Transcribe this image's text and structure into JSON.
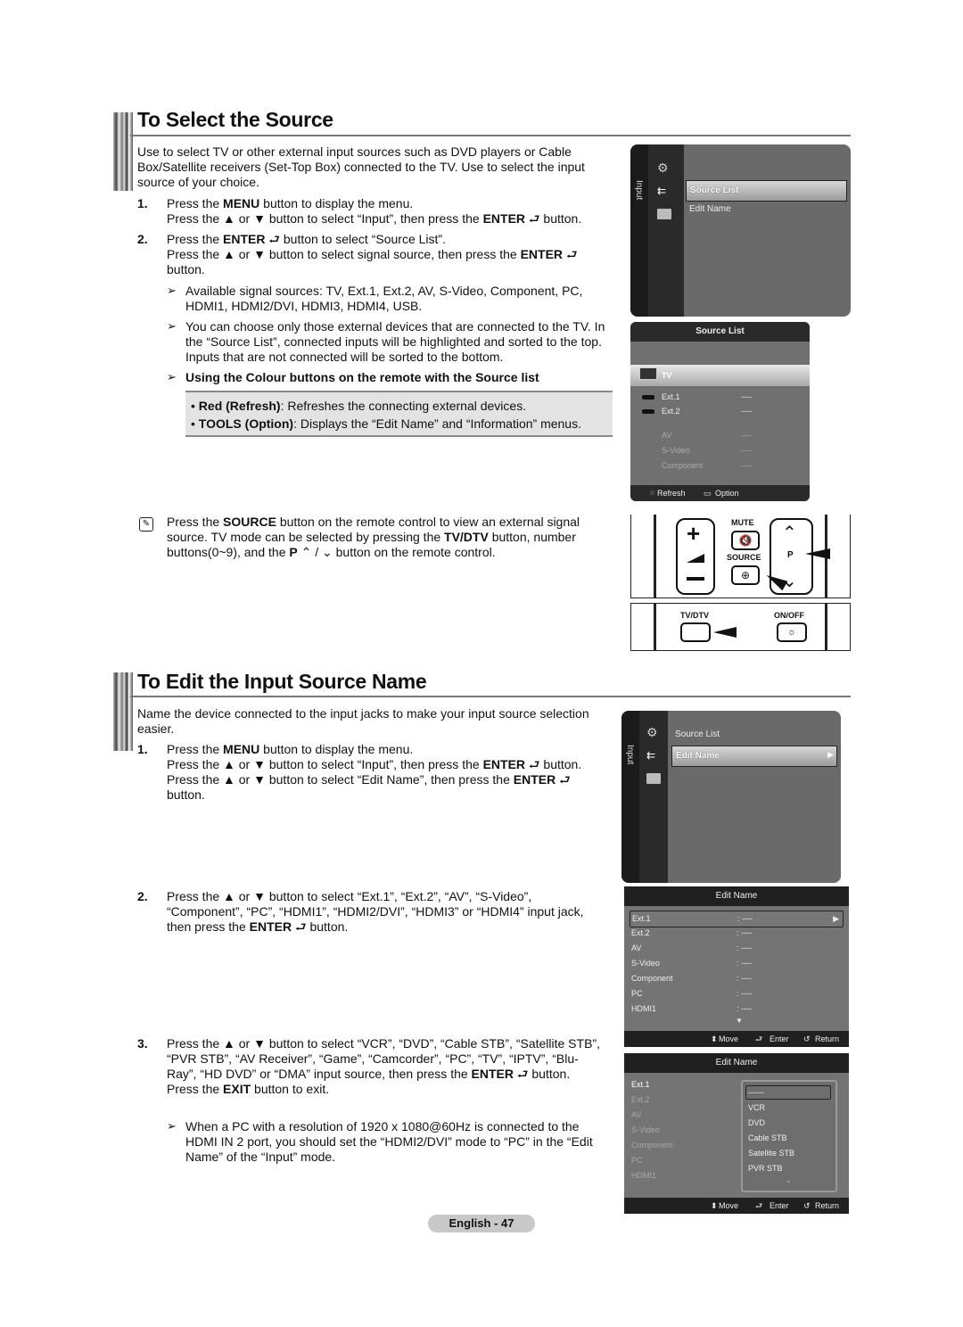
{
  "section1": {
    "title": "To Select the Source",
    "intro": "Use to select TV or other external input sources such as DVD players or Cable Box/Satellite receivers (Set-Top Box) connected to the TV. Use to select the input source of your choice.",
    "step1_num": "1.",
    "step1_line1_pre": "Press the ",
    "step1_line1_bold": "MENU",
    "step1_line1_post": " button to display the menu.",
    "step1_line2_pre": "Press the ▲ or ▼ button to select “Input”, then press the ",
    "step1_line2_bold": "ENTER",
    "step1_line2_post": " button.",
    "step2_num": "2.",
    "step2_line1_pre": "Press the ",
    "step2_line1_bold": "ENTER",
    "step2_line1_post": " button to select “Source List”.",
    "step2_line2_pre": "Press the ▲ or ▼ button to select signal source, then press the ",
    "step2_line2_bold": "ENTER",
    "step2_line2_post": "button.",
    "note1": "Available signal sources: TV, Ext.1, Ext.2, AV, S-Video, Component, PC, HDMI1, HDMI2/DVI, HDMI3, HDMI4, USB.",
    "note2": "You can choose only those external devices that are connected to the TV. In the “Source List”, connected inputs will be highlighted and sorted to the top. Inputs that are not connected will be sorted to the bottom.",
    "note3": "Using the Colour buttons on the remote with the Source list",
    "box_item1_bold": "Red (Refresh)",
    "box_item1_text": ": Refreshes the connecting external devices.",
    "box_item2_bold": "TOOLS (Option)",
    "box_item2_text": ": Displays the “Edit Name” and “Information” menus.",
    "memo_pre": "Press the ",
    "memo_b1": "SOURCE",
    "memo_mid1": " button on the remote control to view an external signal source. TV mode can be selected by pressing the ",
    "memo_b2": "TV/DTV",
    "memo_mid2": " button, number buttons(0~9), and the ",
    "memo_b3": "P",
    "memo_post": " ⌃ / ⌄ button on the remote control."
  },
  "menu1": {
    "category": "Input",
    "items": [
      "Source List",
      "Edit Name"
    ],
    "selected": 0
  },
  "source_list": {
    "title": "Source List",
    "rows": [
      {
        "label": "TV",
        "value": "",
        "state": "selected"
      },
      {
        "label": "Ext.1",
        "value": "----",
        "state": "connected"
      },
      {
        "label": "Ext.2",
        "value": "----",
        "state": "connected"
      },
      {
        "label": "AV",
        "value": "----",
        "state": "dim"
      },
      {
        "label": "S-Video",
        "value": "----",
        "state": "dim"
      },
      {
        "label": "Component",
        "value": "----",
        "state": "dim"
      }
    ],
    "footer_refresh": "Refresh",
    "footer_option": "Option"
  },
  "remote": {
    "mute": "MUTE",
    "source": "SOURCE",
    "p": "P",
    "tvdtv": "TV/DTV",
    "onoff": "ON/OFF"
  },
  "section2": {
    "title": "To Edit the Input Source Name",
    "intro": "Name the device connected to the input jacks to make your input source selection easier.",
    "step1_num": "1.",
    "step1_line1_pre": "Press the ",
    "step1_line1_bold": "MENU",
    "step1_line1_post": " button to display the menu.",
    "step1_line2_pre": "Press the ▲ or ▼ button to select “Input”, then press the ",
    "step1_line2_bold": "ENTER",
    "step1_line2_post": " button.",
    "step1_line3_pre": "Press the ▲ or ▼ button to select “Edit Name”, then press the ",
    "step1_line3_bold": "ENTER",
    "step1_line3_post": "button.",
    "step2_num": "2.",
    "step2_text": "Press the ▲ or ▼ button to select “Ext.1”, “Ext.2”, “AV”, “S-Video”, “Component”, “PC”, “HDMI1”, “HDMI2/DVI”, “HDMI3” or “HDMI4” input jack, then press the ",
    "step2_bold": "ENTER",
    "step2_post": " button.",
    "step3_num": "3.",
    "step3_text": "Press the ▲ or ▼ button to select “VCR”, “DVD”, “Cable STB”, “Satellite STB”, “PVR STB”, “AV Receiver”, “Game”, “Camcorder”, “PC”, “TV”, “IPTV”, “Blu-Ray”, “HD DVD” or “DMA” input source, then press the ",
    "step3_bold": "ENTER",
    "step3_post": " button.",
    "step3_line2_pre": "Press the ",
    "step3_line2_bold": "EXIT",
    "step3_line2_post": " button to exit.",
    "note1": "When a PC with a resolution of 1920 x 1080@60Hz is connected to the HDMI IN 2 port, you should set the “HDMI2/DVI” mode to “PC” in the “Edit Name” of the “Input” mode."
  },
  "menu2": {
    "category": "Input",
    "items": [
      "Source List",
      "Edit Name"
    ],
    "selected": 1
  },
  "edit_name": {
    "title": "Edit Name",
    "rows": [
      {
        "label": "Ext.1",
        "value": ": ----"
      },
      {
        "label": "Ext.2",
        "value": ": ----"
      },
      {
        "label": "AV",
        "value": ": ----"
      },
      {
        "label": "S-Video",
        "value": ": ----"
      },
      {
        "label": "Component",
        "value": ": ----"
      },
      {
        "label": "PC",
        "value": ": ----"
      },
      {
        "label": "HDMI1",
        "value": ": ----"
      }
    ],
    "footer_move": "Move",
    "footer_enter": "Enter",
    "footer_return": "Return"
  },
  "edit_name_dropdown": {
    "title": "Edit Name",
    "options": [
      "------",
      "VCR",
      "DVD",
      "Cable STB",
      "Satellite STB",
      "PVR STB"
    ],
    "selected": 0
  },
  "page_footer": "English - 47"
}
